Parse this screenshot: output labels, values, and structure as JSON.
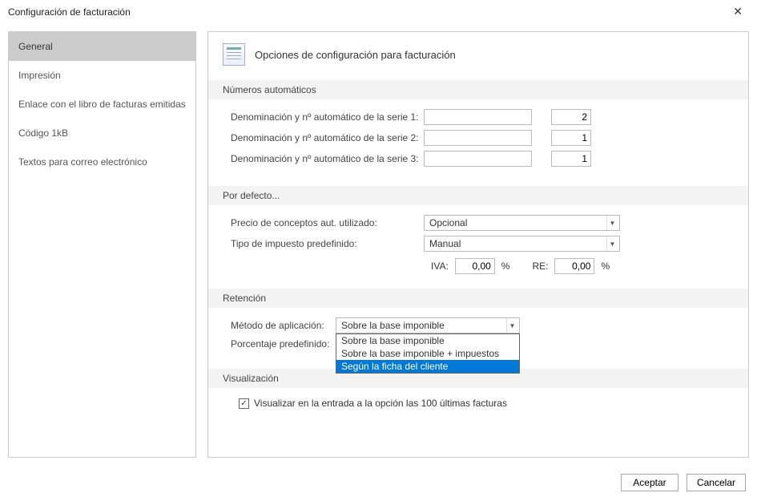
{
  "window": {
    "title": "Configuración de facturación"
  },
  "sidebar": {
    "items": [
      {
        "label": "General"
      },
      {
        "label": "Impresión"
      },
      {
        "label": "Enlace con el libro de facturas emitidas"
      },
      {
        "label": "Código 1kB"
      },
      {
        "label": "Textos para correo electrónico"
      }
    ]
  },
  "main": {
    "header_title": "Opciones de configuración para facturación",
    "sections": {
      "auto_numbers": {
        "title": "Números automáticos",
        "rows": [
          {
            "label": "Denominación y nº automático de la serie 1:",
            "name": "",
            "num": "2"
          },
          {
            "label": "Denominación y nº automático de la serie 2:",
            "name": "",
            "num": "1"
          },
          {
            "label": "Denominación y nº automático de la serie 3:",
            "name": "",
            "num": "1"
          }
        ]
      },
      "defaults": {
        "title": "Por defecto...",
        "price_label": "Precio de conceptos aut. utilizado:",
        "price_value": "Opcional",
        "tax_type_label": "Tipo de impuesto predefinido:",
        "tax_type_value": "Manual",
        "iva_label": "IVA:",
        "iva_value": "0,00",
        "re_label": "RE:",
        "re_value": "0,00",
        "pct": "%"
      },
      "retention": {
        "title": "Retención",
        "method_label": "Método de aplicación:",
        "method_value": "Sobre la base imponible",
        "method_options": [
          "Sobre la base imponible",
          "Sobre la base imponible + impuestos",
          "Según la ficha del cliente"
        ],
        "pct_label": "Porcentaje predefinido:"
      },
      "visualization": {
        "title": "Visualización",
        "checkbox_label": "Visualizar en la entrada a la opción las 100 últimas facturas",
        "checked": true
      }
    }
  },
  "footer": {
    "accept": "Aceptar",
    "cancel": "Cancelar"
  }
}
